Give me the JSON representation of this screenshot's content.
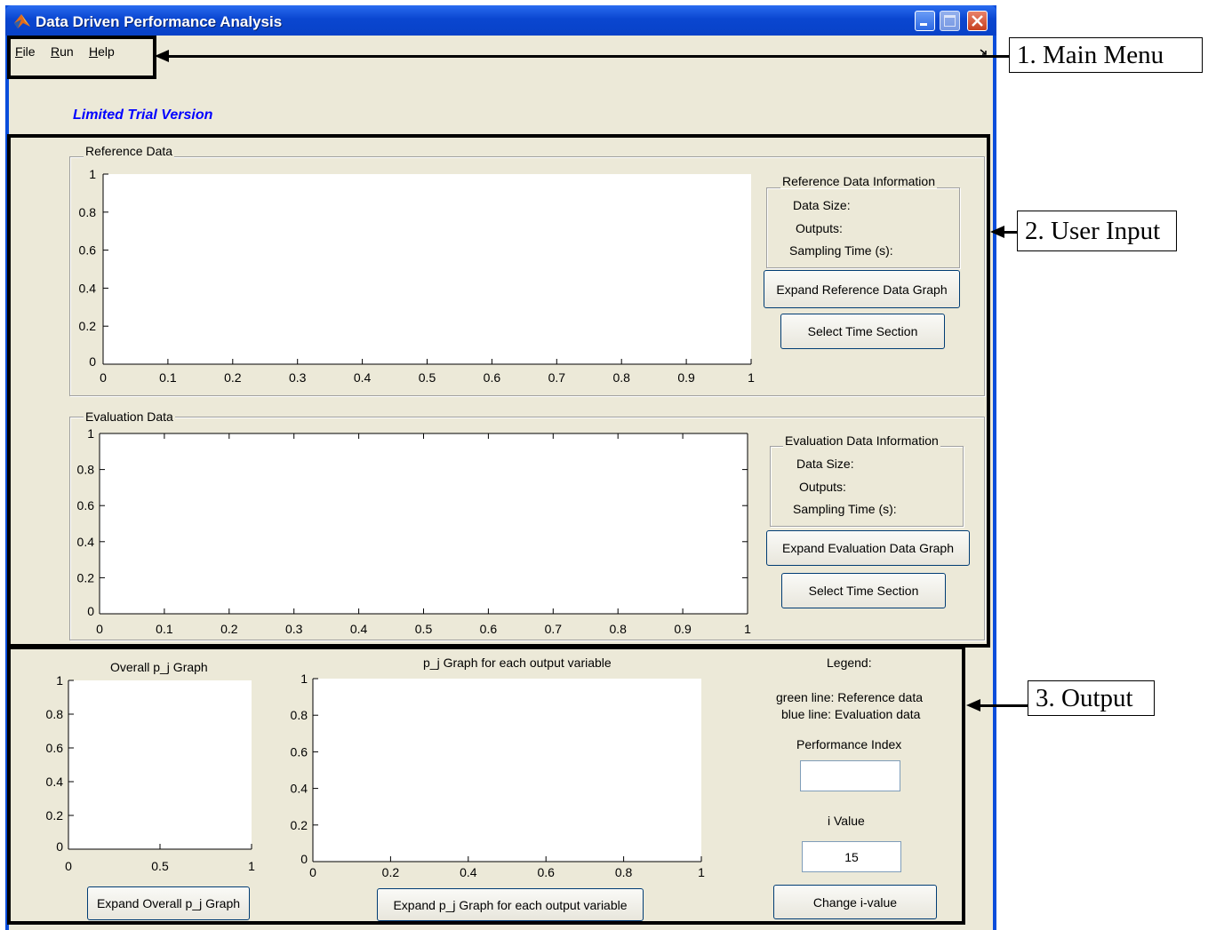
{
  "window": {
    "title": "Data Driven Performance Analysis"
  },
  "menu": {
    "items": [
      {
        "label": "File",
        "accel": "F",
        "rest": "ile"
      },
      {
        "label": "Run",
        "accel": "R",
        "rest": "un"
      },
      {
        "label": "Help",
        "accel": "H",
        "rest": "elp"
      }
    ],
    "dock_icon": "dock-arrow-icon"
  },
  "trial_text": "Limited Trial Version",
  "reference": {
    "group_title": "Reference Data",
    "info_title": "Reference Data Information",
    "data_size_label": "Data Size:",
    "outputs_label": "Outputs:",
    "sampling_label": "Sampling Time (s):",
    "expand_button": "Expand Reference Data Graph",
    "select_button": "Select Time Section"
  },
  "evaluation": {
    "group_title": "Evaluation Data",
    "info_title": "Evaluation Data Information",
    "data_size_label": "Data Size:",
    "outputs_label": "Outputs:",
    "sampling_label": "Sampling Time (s):",
    "expand_button": "Expand Evaluation Data Graph",
    "select_button": "Select Time Section"
  },
  "output": {
    "overall_title": "Overall p_j Graph",
    "each_title": "p_j Graph for each output variable",
    "legend_title": "Legend:",
    "legend_green": "green line: Reference data",
    "legend_blue": "blue line: Evaluation data",
    "perf_label": "Performance Index",
    "perf_value": "",
    "i_label": "i Value",
    "i_value": "15",
    "expand_overall_button": "Expand Overall p_j Graph",
    "expand_each_button": "Expand p_j Graph for each output variable",
    "change_i_button": "Change i-value"
  },
  "annotations": {
    "main_menu": "1. Main Menu",
    "user_input": "2. User Input",
    "output": "3. Output"
  },
  "chart_data": [
    {
      "name": "reference-axes",
      "type": "line",
      "x_ticks": [
        "0",
        "0.1",
        "0.2",
        "0.3",
        "0.4",
        "0.5",
        "0.6",
        "0.7",
        "0.8",
        "0.9",
        "1"
      ],
      "y_ticks": [
        "0",
        "0.2",
        "0.4",
        "0.6",
        "0.8",
        "1"
      ],
      "xlim": [
        0,
        1
      ],
      "ylim": [
        0,
        1
      ],
      "series": []
    },
    {
      "name": "evaluation-axes",
      "type": "line",
      "x_ticks": [
        "0",
        "0.1",
        "0.2",
        "0.3",
        "0.4",
        "0.5",
        "0.6",
        "0.7",
        "0.8",
        "0.9",
        "1"
      ],
      "y_ticks": [
        "0",
        "0.2",
        "0.4",
        "0.6",
        "0.8",
        "1"
      ],
      "xlim": [
        0,
        1
      ],
      "ylim": [
        0,
        1
      ],
      "series": []
    },
    {
      "name": "overall-pj-axes",
      "type": "line",
      "x_ticks": [
        "0",
        "0.5",
        "1"
      ],
      "y_ticks": [
        "0",
        "0.2",
        "0.4",
        "0.6",
        "0.8",
        "1"
      ],
      "xlim": [
        0,
        1
      ],
      "ylim": [
        0,
        1
      ],
      "series": []
    },
    {
      "name": "each-pj-axes",
      "type": "line",
      "x_ticks": [
        "0",
        "0.2",
        "0.4",
        "0.6",
        "0.8",
        "1"
      ],
      "y_ticks": [
        "0",
        "0.2",
        "0.4",
        "0.6",
        "0.8",
        "1"
      ],
      "xlim": [
        0,
        1
      ],
      "ylim": [
        0,
        1
      ],
      "series": []
    }
  ]
}
